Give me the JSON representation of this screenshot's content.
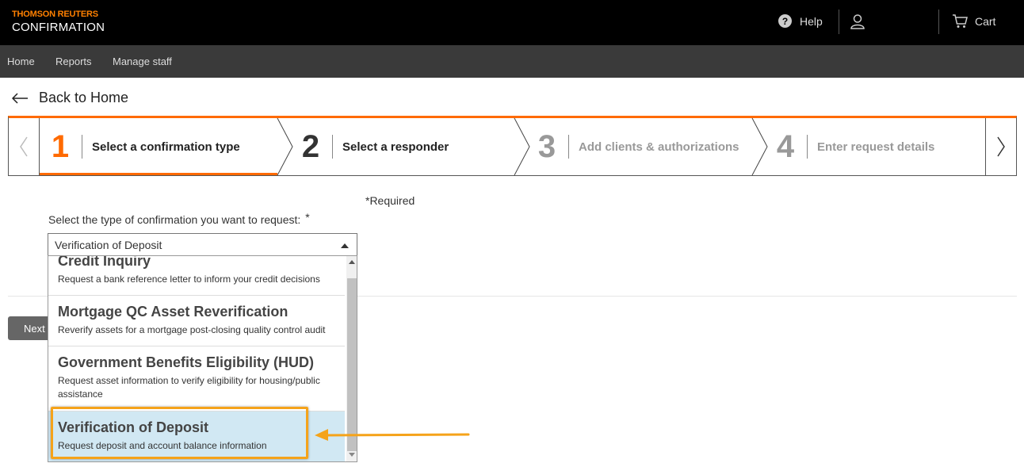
{
  "header": {
    "brand_top": "THOMSON REUTERS",
    "brand_bottom": "CONFIRMATION",
    "help_label": "Help",
    "cart_label": "Cart"
  },
  "nav": {
    "items": [
      {
        "label": "Home"
      },
      {
        "label": "Reports"
      },
      {
        "label": "Manage staff"
      }
    ]
  },
  "back": {
    "label": "Back to Home"
  },
  "stepper": {
    "steps": [
      {
        "num": "1",
        "label": "Select a confirmation type",
        "state": "active"
      },
      {
        "num": "2",
        "label": "Select a responder",
        "state": "enabled"
      },
      {
        "num": "3",
        "label": "Add clients & authorizations",
        "state": "disabled"
      },
      {
        "num": "4",
        "label": "Enter request details",
        "state": "disabled"
      }
    ]
  },
  "form": {
    "required_note": "*Required",
    "select_label": "Select the type of confirmation you want to request:",
    "select_required_mark": "*",
    "selected_value": "Verification of Deposit",
    "next_label": "Next"
  },
  "dropdown": {
    "options": [
      {
        "title": "Credit Inquiry",
        "desc": "Request a bank reference letter to inform your credit decisions"
      },
      {
        "title": "Mortgage QC Asset Reverification",
        "desc": "Reverify assets for a mortgage post-closing quality control audit"
      },
      {
        "title": "Government Benefits Eligibility (HUD)",
        "desc": "Request asset information to verify eligibility for housing/public assistance"
      },
      {
        "title": "Verification of Deposit",
        "desc": "Request deposit and account balance information"
      }
    ]
  },
  "colors": {
    "accent": "#ff6a00",
    "highlight": "#f5a31a",
    "selected_bg": "#d1e8f3",
    "header_bg": "#000000",
    "nav_bg": "#3a3a3a"
  }
}
